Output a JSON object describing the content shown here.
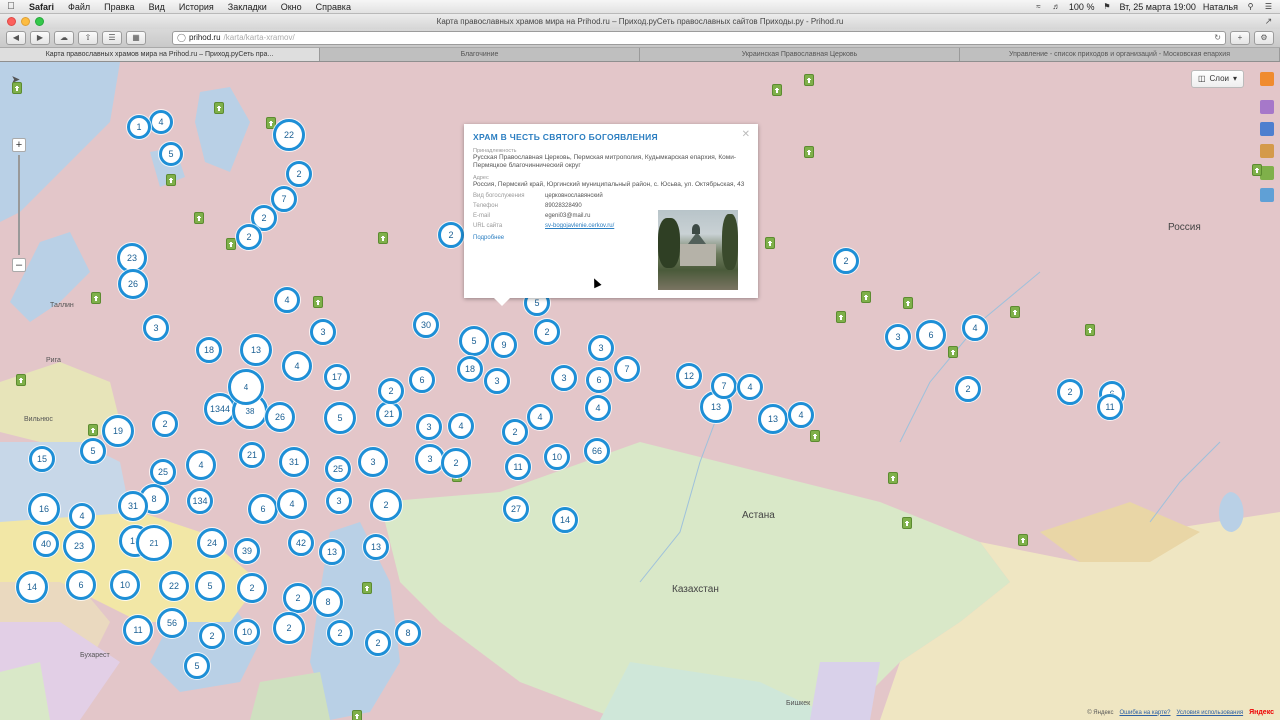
{
  "menubar": {
    "app": "Safari",
    "items": [
      "Файл",
      "Правка",
      "Вид",
      "История",
      "Закладки",
      "Окно",
      "Справка"
    ],
    "battery": "100 %",
    "datetime": "Вт, 25 марта  19:00",
    "user": "Наталья"
  },
  "window": {
    "title": "Карта православных храмов мира на Prihod.ru – Приход.руСеть православных сайтов Приходы.ру - Prihod.ru"
  },
  "toolbar": {
    "url_host": "prihod.ru",
    "url_path": "/karta/karta-xramov/"
  },
  "tabs": [
    "Карта православных храмов мира на Prihod.ru – Приход.руСеть пра...",
    "Благочиние",
    "Украинская Православная Церковь",
    "Управление - список приходов и организаций - Московская епархия"
  ],
  "layers_label": "Слои",
  "popup": {
    "title": "ХРАМ В ЧЕСТЬ СВЯТОГО БОГОЯВЛЕНИЯ",
    "jurisdiction_label": "Принадлежность",
    "jurisdiction": "Русская Православная Церковь, Пермская митрополия, Кудымкарская епархия, Коми-Пермяцкое благочиннический округ",
    "address_label": "Адрес",
    "address": "Россия, Пермский край, Юргинский муниципальный район, с. Юсьва, ул. Октябрьская, 43",
    "rows": [
      {
        "k": "Вид богослужения",
        "v": "церковнославянский"
      },
      {
        "k": "Телефон",
        "v": "89028328490"
      },
      {
        "k": "E-mail",
        "v": "egeni03@mail.ru"
      },
      {
        "k": "URL сайта",
        "v": "sv-bogojavlenie.cerkov.ru/"
      }
    ],
    "more": "Подробнее"
  },
  "places": [
    {
      "t": "Россия",
      "big": true
    },
    {
      "t": "Казахстан",
      "big": true
    },
    {
      "t": "Астана",
      "big": true
    },
    {
      "t": "Рига"
    },
    {
      "t": "Вильнюс"
    },
    {
      "t": "Бухарест"
    },
    {
      "t": "Бишкек"
    },
    {
      "t": "Таллин"
    }
  ],
  "clusters": [
    "4",
    "1",
    "5",
    "22",
    "2",
    "7",
    "2",
    "2",
    "23",
    "26",
    "2",
    "4",
    "3",
    "18",
    "13",
    "4",
    "3",
    "30",
    "5",
    "9",
    "5",
    "2",
    "18",
    "3",
    "3",
    "7",
    "3",
    "6",
    "12",
    "13",
    "7",
    "4",
    "13",
    "4",
    "2",
    "3",
    "6",
    "4",
    "2",
    "2",
    "6",
    "11",
    "1344",
    "38",
    "26",
    "5",
    "21",
    "2",
    "6",
    "17",
    "4",
    "2",
    "19",
    "5",
    "15",
    "4",
    "21",
    "31",
    "25",
    "3",
    "3",
    "2",
    "3",
    "4",
    "2",
    "4",
    "11",
    "10",
    "66",
    "4",
    "27",
    "14",
    "16",
    "4",
    "8",
    "31",
    "134",
    "25",
    "6",
    "4",
    "3",
    "2",
    "40",
    "23",
    "18",
    "21",
    "24",
    "39",
    "42",
    "13",
    "13",
    "14",
    "6",
    "10",
    "22",
    "5",
    "2",
    "2",
    "8",
    "11",
    "56",
    "2",
    "10",
    "2",
    "2",
    "2",
    "8",
    "5"
  ],
  "footer": {
    "copy": "© Яндекс",
    "error": "Ошибка на карте?",
    "terms": "Условия использования",
    "logo": "Яндекс"
  }
}
